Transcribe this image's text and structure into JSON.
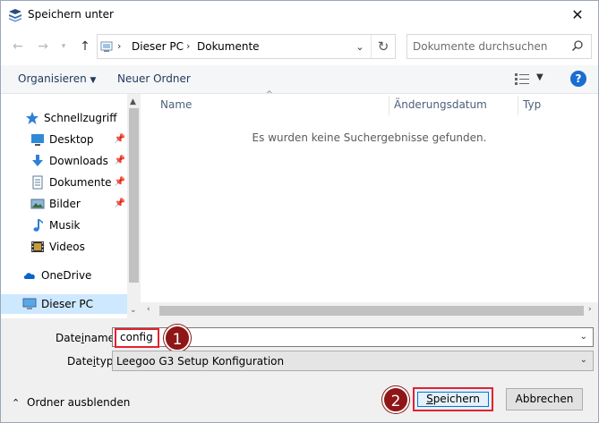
{
  "window": {
    "title": "Speichern unter",
    "close_glyph": "✕"
  },
  "nav": {
    "back_glyph": "←",
    "forward_glyph": "→",
    "up_glyph": "↑",
    "breadcrumb": [
      "Dieser PC",
      "Dokumente"
    ],
    "refresh_glyph": "↻",
    "search_placeholder": "Dokumente durchsuchen"
  },
  "toolbar": {
    "organize_label": "Organisieren",
    "new_folder_label": "Neuer Ordner",
    "help_label": "?"
  },
  "sidebar": {
    "items": [
      {
        "label": "Schnellzugriff",
        "icon": "star-icon",
        "pinned": false
      },
      {
        "label": "Desktop",
        "icon": "desktop-icon",
        "pinned": true
      },
      {
        "label": "Downloads",
        "icon": "download-icon",
        "pinned": true
      },
      {
        "label": "Dokumente",
        "icon": "document-icon",
        "pinned": true
      },
      {
        "label": "Bilder",
        "icon": "pictures-icon",
        "pinned": true
      },
      {
        "label": "Musik",
        "icon": "music-icon",
        "pinned": false
      },
      {
        "label": "Videos",
        "icon": "video-icon",
        "pinned": false
      },
      {
        "label": "OneDrive",
        "icon": "cloud-icon",
        "pinned": false
      },
      {
        "label": "Dieser PC",
        "icon": "computer-icon",
        "pinned": false,
        "selected": true
      }
    ]
  },
  "content": {
    "columns": [
      "Name",
      "Änderungsdatum",
      "Typ"
    ],
    "empty_message": "Es wurden keine Suchergebnisse gefunden."
  },
  "form": {
    "filename_label_pre": "Date",
    "filename_label_u": "i",
    "filename_label_post": "name:",
    "filename_value": "config",
    "filetype_label_pre": "Date",
    "filetype_label_u": "i",
    "filetype_label_post": "typ:",
    "filetype_value": "Leegoo G3 Setup Konfiguration",
    "hide_folders_label": "Ordner ausblenden",
    "save_label_u": "S",
    "save_label_rest": "peichern",
    "cancel_label": "Abbrechen"
  },
  "annotations": {
    "step1": "1",
    "step2": "2"
  },
  "colors": {
    "highlight": "#e5212f",
    "badge": "#8e1616",
    "accent": "#0078d7",
    "selection": "#cde8ff"
  }
}
